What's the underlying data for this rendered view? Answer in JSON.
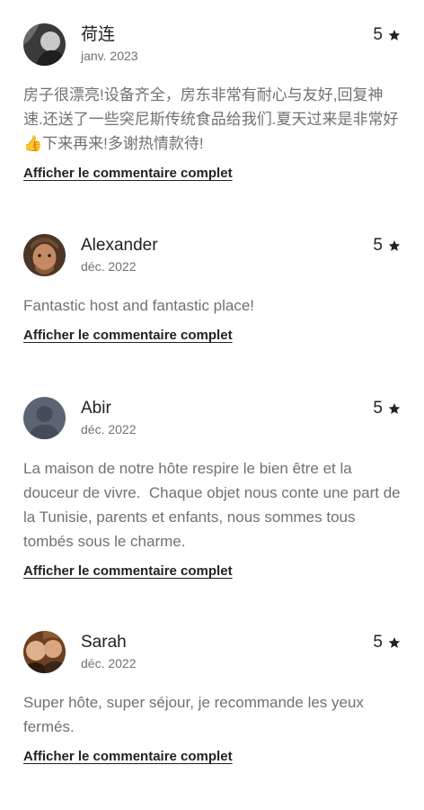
{
  "reviews": [
    {
      "name": "荷连",
      "date": "janv. 2023",
      "rating": "5",
      "text": "房子很漂亮!设备齐全，房东非常有耐心与友好,回复神速.还送了一些突尼斯传统食品给我们.夏天过来是非常好👍下来再来!多谢热情款待!",
      "more_label": "Afficher le commentaire complet",
      "avatar_icon": "user-photo-icon"
    },
    {
      "name": "Alexander",
      "date": "déc. 2022",
      "rating": "5",
      "text": "Fantastic host and fantastic place!",
      "more_label": "Afficher le commentaire complet",
      "avatar_icon": "user-photo-icon"
    },
    {
      "name": "Abir",
      "date": "déc. 2022",
      "rating": "5",
      "text": "La maison de notre hôte respire le bien être et la douceur de vivre.  Chaque objet nous conte une part de la Tunisie, parents et enfants, nous sommes tous tombés sous le charme.",
      "more_label": "Afficher le commentaire complet",
      "avatar_icon": "default-avatar-icon"
    },
    {
      "name": "Sarah",
      "date": "déc. 2022",
      "rating": "5",
      "text": "Super hôte, super séjour, je recommande les yeux fermés.",
      "more_label": "Afficher le commentaire complet",
      "avatar_icon": "user-photo-icon"
    }
  ],
  "star_icon": "star-icon",
  "colors": {
    "primary_text": "#222222",
    "secondary_text": "#717171",
    "background": "#ffffff"
  }
}
